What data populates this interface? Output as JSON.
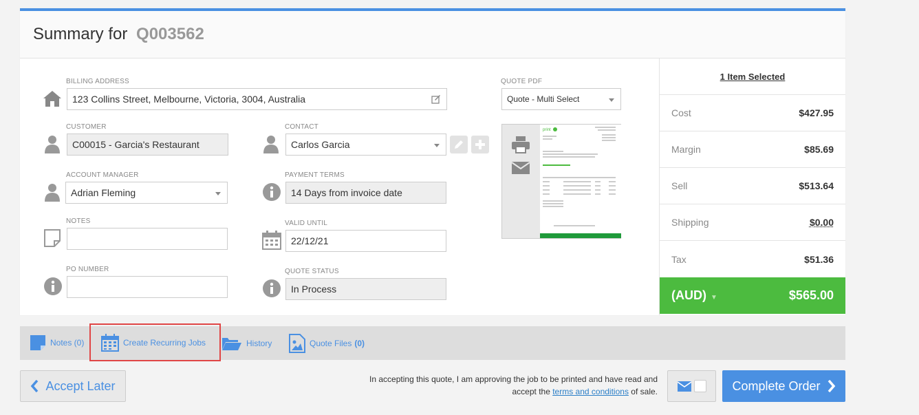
{
  "header": {
    "title_prefix": "Summary for",
    "quote_id": "Q003562"
  },
  "billing": {
    "label": "BILLING ADDRESS",
    "value": "123 Collins Street, Melbourne, Victoria, 3004, Australia"
  },
  "customer": {
    "label": "CUSTOMER",
    "value": "C00015 - Garcia's Restaurant"
  },
  "contact": {
    "label": "CONTACT",
    "value": "Carlos Garcia"
  },
  "account_manager": {
    "label": "ACCOUNT MANAGER",
    "value": "Adrian Fleming"
  },
  "payment_terms": {
    "label": "PAYMENT TERMS",
    "value": "14 Days from invoice date"
  },
  "notes": {
    "label": "NOTES",
    "value": ""
  },
  "valid_until": {
    "label": "VALID UNTIL",
    "value": "22/12/21"
  },
  "po_number": {
    "label": "PO NUMBER",
    "value": ""
  },
  "quote_status": {
    "label": "QUOTE STATUS",
    "value": "In Process"
  },
  "quote_pdf": {
    "label": "QUOTE PDF",
    "value": "Quote - Multi Select"
  },
  "summary": {
    "heading": "1 Item Selected",
    "rows": [
      {
        "label": "Cost",
        "value": "$427.95"
      },
      {
        "label": "Margin",
        "value": "$85.69"
      },
      {
        "label": "Sell",
        "value": "$513.64"
      },
      {
        "label": "Shipping",
        "value": "$0.00"
      },
      {
        "label": "Tax",
        "value": "$51.36"
      }
    ],
    "currency": "(AUD)",
    "total": "$565.00"
  },
  "tabs": {
    "notes": "Notes (0)",
    "recurring": "Create Recurring Jobs",
    "history": "History",
    "files": "Quote Files",
    "files_count": "(0)"
  },
  "footer": {
    "accept_later": "Accept Later",
    "terms_before": "In accepting this quote, I am approving the job to be printed and have read and accept the",
    "terms_link": "terms and conditions",
    "terms_after": "of sale.",
    "complete": "Complete Order"
  },
  "colors": {
    "accent": "#4a90e2",
    "total_bg": "#4cbb3f",
    "highlight": "#e04545"
  }
}
